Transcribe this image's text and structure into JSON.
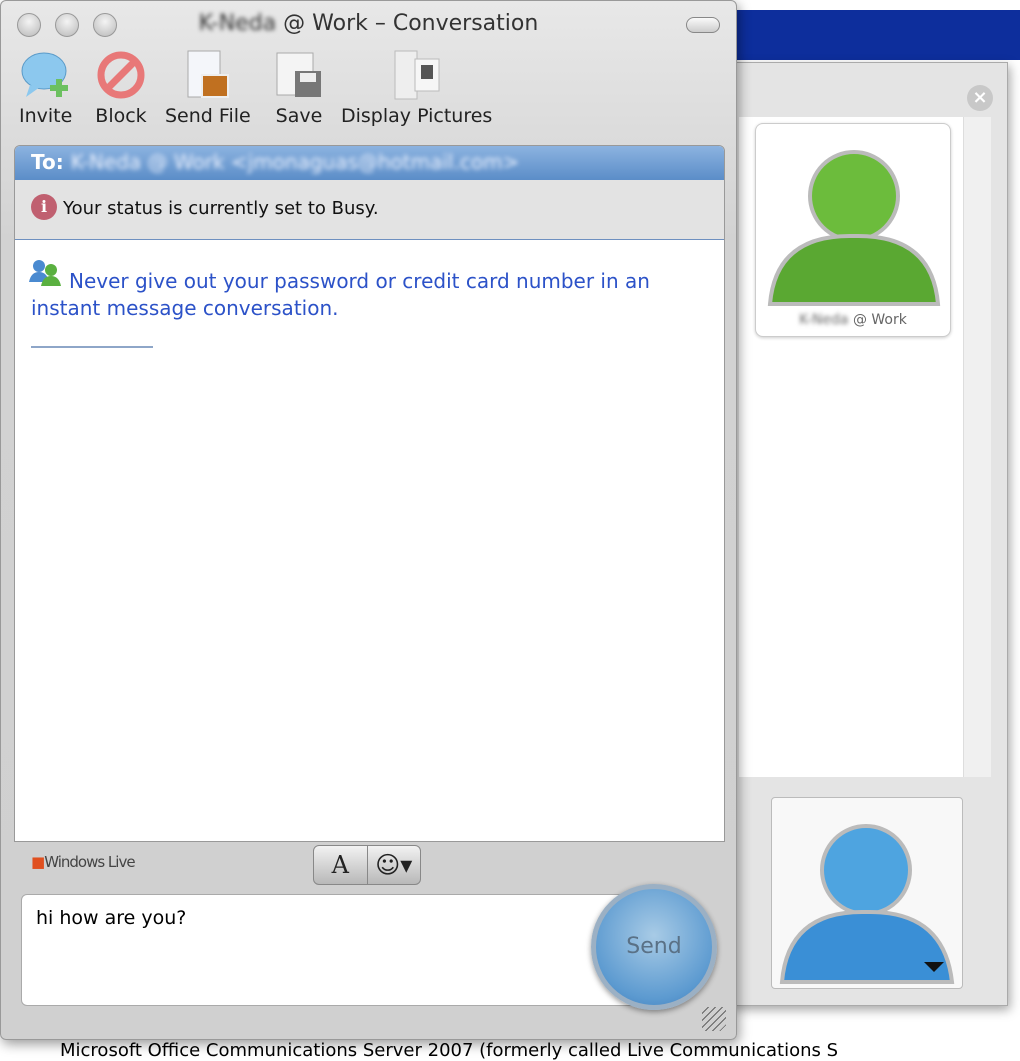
{
  "window": {
    "title_blurred": "K-Neda",
    "title": "@ Work – Conversation"
  },
  "toolbar": [
    {
      "label": "Invite",
      "icon": "invite-icon"
    },
    {
      "label": "Block",
      "icon": "block-icon"
    },
    {
      "label": "Send File",
      "icon": "send-file-icon"
    },
    {
      "label": "Save",
      "icon": "save-icon"
    },
    {
      "label": "Display Pictures",
      "icon": "display-pictures-icon"
    }
  ],
  "conversation": {
    "to_label": "To:",
    "to_address": "K-Neda @ Work <jmonaguas@hotmail.com>",
    "status_message": "Your status is currently set to Busy.",
    "warning": "Never give out your password or credit card number in an instant message conversation."
  },
  "footer": {
    "brand": "Windows Live",
    "font_button": "A",
    "emoticon_button": "☺▾",
    "message_input": "hi how are you?",
    "send_label": "Send"
  },
  "contact": {
    "name_blurred": "K-Neda",
    "name": "@ Work",
    "avatar_color": "#5aa832"
  },
  "self": {
    "avatar_color": "#3a8fd6"
  },
  "background_text": "Microsoft Office Communications Server 2007 (formerly called Live Communications S"
}
